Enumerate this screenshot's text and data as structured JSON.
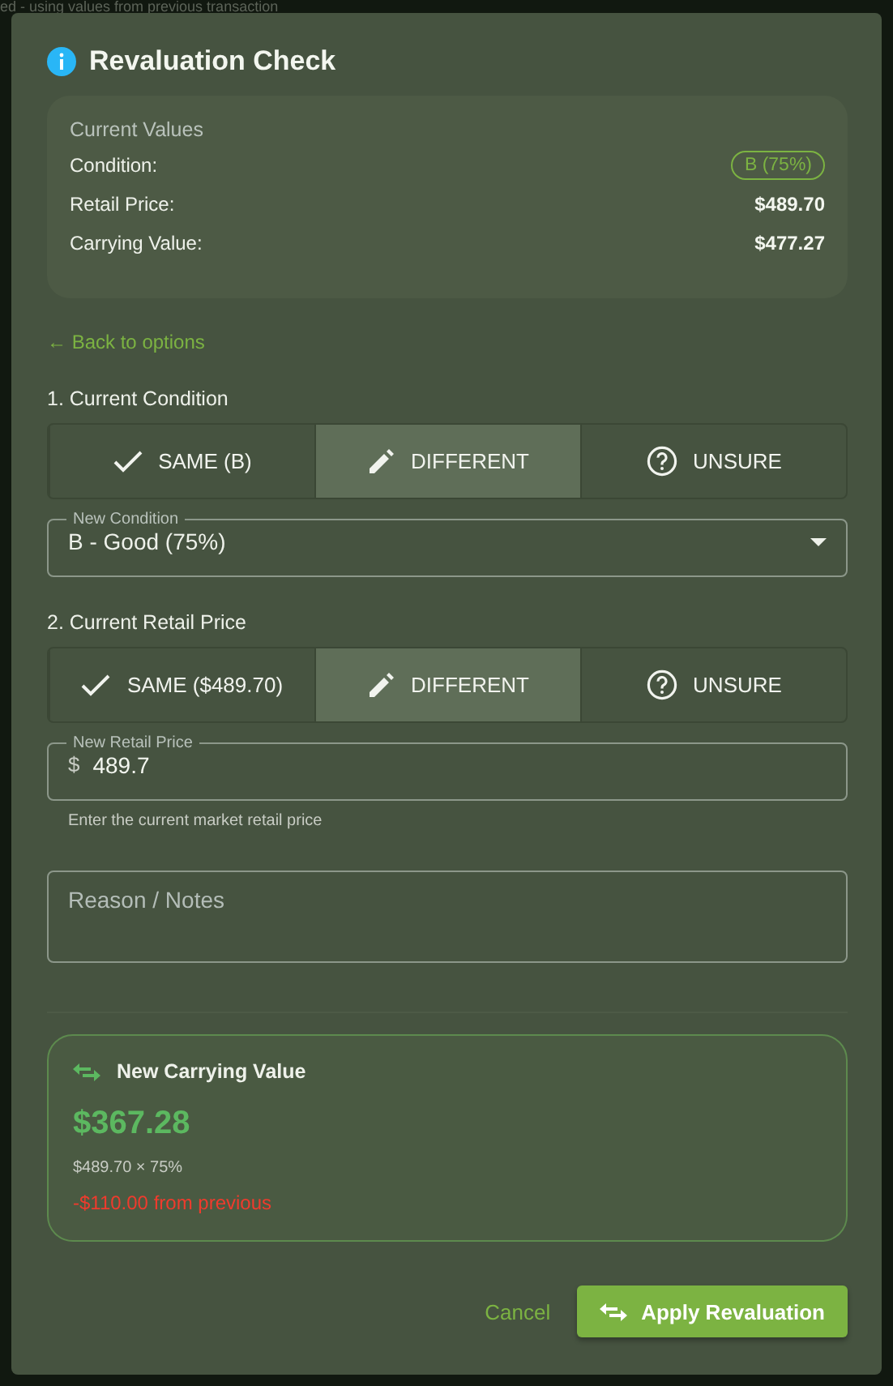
{
  "background": {
    "notice": "ed - using values from previous transaction"
  },
  "dialog": {
    "title": "Revaluation Check",
    "current_values": {
      "heading": "Current Values",
      "rows": [
        {
          "label": "Condition:",
          "value": "B (75%)",
          "kind": "badge"
        },
        {
          "label": "Retail Price:",
          "value": "$489.70",
          "kind": "text"
        },
        {
          "label": "Carrying Value:",
          "value": "$477.27",
          "kind": "text"
        }
      ]
    },
    "back_link": "← Back to options",
    "sections": [
      {
        "heading": "1. Current Condition",
        "options": [
          {
            "label": "SAME (B)",
            "kind": "same",
            "selected": false
          },
          {
            "label": "DIFFERENT",
            "kind": "different",
            "selected": true
          },
          {
            "label": "UNSURE",
            "kind": "unsure",
            "selected": false
          }
        ],
        "field": {
          "kind": "select",
          "label": "New Condition",
          "value": "B - Good (75%)"
        }
      },
      {
        "heading": "2. Current Retail Price",
        "options": [
          {
            "label": "SAME ($489.70)",
            "kind": "same",
            "selected": false
          },
          {
            "label": "DIFFERENT",
            "kind": "different",
            "selected": true
          },
          {
            "label": "UNSURE",
            "kind": "unsure",
            "selected": false
          }
        ],
        "field": {
          "kind": "currency",
          "label": "New Retail Price",
          "prefix": "$",
          "value": "489.7",
          "helper": "Enter the current market retail price"
        }
      }
    ],
    "notes": {
      "placeholder": "Reason / Notes"
    },
    "result": {
      "title": "New Carrying Value",
      "amount": "$367.28",
      "formula": "$489.70 × 75%",
      "change": "-$110.00 from previous"
    },
    "actions": [
      {
        "label": "Cancel",
        "kind": "text"
      },
      {
        "label": "Apply Revaluation",
        "kind": "primary"
      }
    ]
  }
}
